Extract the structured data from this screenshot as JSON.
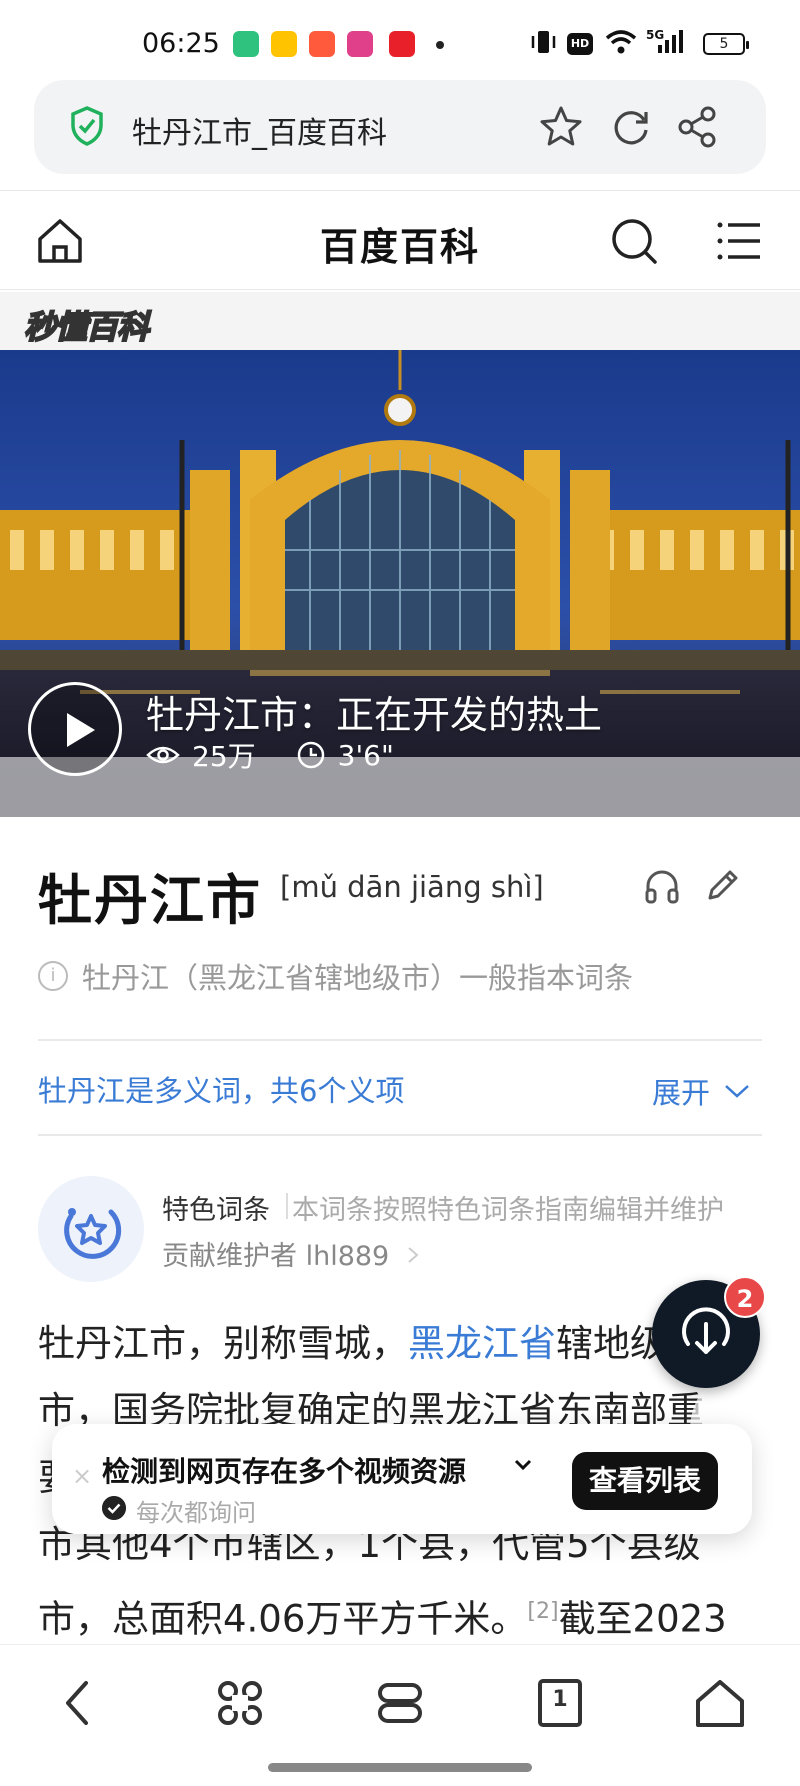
{
  "status_bar": {
    "time": "06:25",
    "network": "5G",
    "hd": "HD",
    "battery": "5",
    "app_icon_colors": [
      "#2ec27e",
      "#ffc300",
      "#ff5a3c",
      "#e0408a",
      "#e8202a"
    ]
  },
  "url_bar": {
    "title": "牡丹江市_百度百科",
    "icons": [
      "shield-check-icon",
      "star-icon",
      "refresh-icon",
      "share-icon"
    ]
  },
  "header": {
    "title": "百度百科",
    "icons": [
      "home-icon",
      "search-icon",
      "menu-icon"
    ]
  },
  "video": {
    "brand": "秒懂百科",
    "title": "牡丹江市：正在开发的热土",
    "views": "25万",
    "duration": "3'6\""
  },
  "entry": {
    "title": "牡丹江市",
    "pinyin": "[mǔ dān jiāng shì]",
    "note": "牡丹江（黑龙江省辖地级市）一般指本词条",
    "polysemy": "牡丹江是多义词，共6个义项",
    "expand": "展开"
  },
  "feature": {
    "label": "特色词条",
    "desc": "本词条按照特色词条指南编辑并维护",
    "maintainer": "贡献维护者 lhl889"
  },
  "body": {
    "p1_a": "牡丹江市，别称雪城，",
    "p1_link": "黑龙江省",
    "p1_b": "辖地级",
    "line2": "市，国务院批复确定的黑龙江省东南部重",
    "line3": "要",
    "line4": "市其他4个市辖区，1个县，代管5个县级",
    "line5_a": "市，总面积4.06万平方千米。",
    "ref": "[2]",
    "line5_b": "截至2023"
  },
  "float": {
    "badge": "2"
  },
  "popup": {
    "title": "检测到网页存在多个视频资源",
    "sub": "每次都询问",
    "button": "查看列表",
    "close": "×"
  },
  "bottom_nav": {
    "items": [
      "back-icon",
      "features-icon",
      "tabs-stack-icon",
      "tab-count-icon",
      "home-icon"
    ],
    "tab_count": "1"
  }
}
